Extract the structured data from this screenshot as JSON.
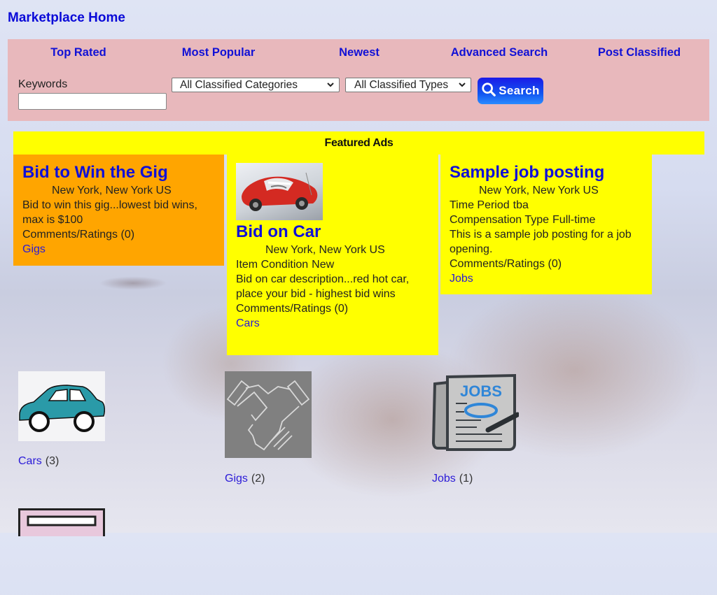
{
  "header": {
    "home_link": "Marketplace Home"
  },
  "nav": {
    "items": [
      {
        "label": "Top Rated"
      },
      {
        "label": "Most Popular"
      },
      {
        "label": "Newest"
      },
      {
        "label": "Advanced Search"
      },
      {
        "label": "Post Classified"
      }
    ]
  },
  "search": {
    "keywords_label": "Keywords",
    "keywords_value": "",
    "keywords_placeholder": "",
    "category_select": "All Classified Categories",
    "type_select": "All Classified Types",
    "button_label": "Search"
  },
  "featured": {
    "heading": "Featured Ads",
    "ads": [
      {
        "title": "Bid to Win the Gig",
        "location": "New York, New York US",
        "description": "Bid to win this gig...lowest bid wins, max is $100",
        "comments": "Comments/Ratings (0)",
        "category": "Gigs",
        "background": "#ffa500"
      },
      {
        "title": "Bid on Car",
        "location": "New York, New York US",
        "fields": [
          {
            "key": "Item Condition",
            "value": "New"
          }
        ],
        "description": "Bid on car description...red hot car, place your bid - highest bid wins",
        "comments": "Comments/Ratings (0)",
        "category": "Cars",
        "thumbnail": "red-toy-car-photo",
        "background": "#ffff00"
      },
      {
        "title": "Sample job posting",
        "location": "New York, New York US",
        "fields": [
          {
            "key": "Time Period",
            "value": "tba"
          },
          {
            "key": "Compensation Type",
            "value": "Full-time"
          }
        ],
        "description": "This is a sample job posting for a job opening.",
        "comments": "Comments/Ratings (0)",
        "category": "Jobs",
        "background": "#ffff00"
      }
    ]
  },
  "categories": [
    {
      "name": "Cars",
      "count": "(3)",
      "icon": "teal-car-icon"
    },
    {
      "name": "Gigs",
      "count": "(2)",
      "icon": "handshake-icon"
    },
    {
      "name": "Jobs",
      "count": "(1)",
      "icon": "jobs-newspaper-icon"
    },
    {
      "name": "",
      "count": "",
      "icon": "pink-sign-icon"
    }
  ],
  "colors": {
    "link": "#1a10e0",
    "toolbar_bg": "#e8b8bc",
    "featured_yellow": "#ffff00",
    "gig_orange": "#ffa500",
    "search_button": "#1255f0"
  }
}
